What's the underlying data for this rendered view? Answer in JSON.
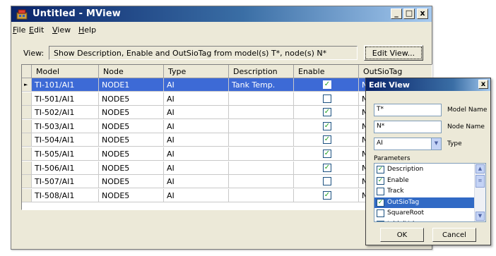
{
  "window": {
    "title": "Untitled - MView",
    "minimize": "_",
    "maximize": "□",
    "close": "x"
  },
  "menu": {
    "file": "F",
    "file_rest": "ile",
    "edit": "E",
    "edit_rest": "dit",
    "view": "V",
    "view_rest": "iew",
    "help": "H",
    "help_rest": "elp"
  },
  "view_bar": {
    "label": "View:",
    "text": "Show Description, Enable and OutSioTag from model(s) T*, node(s) N*",
    "edit_button": "Edit View..."
  },
  "grid": {
    "columns": [
      "Model",
      "Node",
      "Type",
      "Description",
      "Enable",
      "OutSioTag"
    ],
    "rows": [
      {
        "model": "TI-101/AI1",
        "node": "NODE1",
        "type": "AI",
        "description": "Tank Temp.",
        "enable": "✓",
        "outsiotag": "N"
      },
      {
        "model": "TI-501/AI1",
        "node": "NODE5",
        "type": "AI",
        "description": "",
        "enable": "",
        "outsiotag": "N"
      },
      {
        "model": "TI-502/AI1",
        "node": "NODE5",
        "type": "AI",
        "description": "",
        "enable": "✓",
        "outsiotag": "N"
      },
      {
        "model": "TI-503/AI1",
        "node": "NODE5",
        "type": "AI",
        "description": "",
        "enable": "✓",
        "outsiotag": "N"
      },
      {
        "model": "TI-504/AI1",
        "node": "NODE5",
        "type": "AI",
        "description": "",
        "enable": "✓",
        "outsiotag": "N"
      },
      {
        "model": "TI-505/AI1",
        "node": "NODE5",
        "type": "AI",
        "description": "",
        "enable": "✓",
        "outsiotag": "N"
      },
      {
        "model": "TI-506/AI1",
        "node": "NODE5",
        "type": "AI",
        "description": "",
        "enable": "✓",
        "outsiotag": "N"
      },
      {
        "model": "TI-507/AI1",
        "node": "NODE5",
        "type": "AI",
        "description": "",
        "enable": "",
        "outsiotag": "N"
      },
      {
        "model": "TI-508/AI1",
        "node": "NODE5",
        "type": "AI",
        "description": "",
        "enable": "✓",
        "outsiotag": "N"
      }
    ],
    "selected_row_marker": "►"
  },
  "dialog": {
    "title": "Edit View",
    "close": "x",
    "model_value": "T*",
    "model_label": "Model Name",
    "node_value": "N*",
    "node_label": "Node Name",
    "type_value": "AI",
    "type_label": "Type",
    "params_label": "Parameters",
    "params": [
      {
        "label": "Description",
        "checked": "✓"
      },
      {
        "label": "Enable",
        "checked": "✓"
      },
      {
        "label": "Track",
        "checked": ""
      },
      {
        "label": "OutSioTag",
        "checked": "✓"
      },
      {
        "label": "SquareRoot",
        "checked": ""
      },
      {
        "label": "InitialValue",
        "checked": ""
      }
    ],
    "ok": "OK",
    "cancel": "Cancel"
  }
}
